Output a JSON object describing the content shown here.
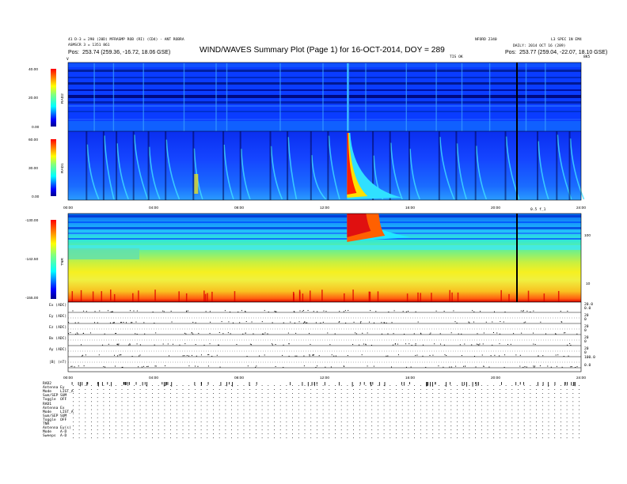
{
  "header": {
    "title": "WIND/WAVES Summary Plot (Page 1) for 16-OCT-2014, DOY = 289",
    "top_left_line1": "41 D-3 = 290 (20D) MFRASMP ROB (RI) (CD4) - ANT ROBRA",
    "top_left_line2": "ASMSCR 3 = 1351 861",
    "pos_left_label": "Pos:",
    "pos_left_value": "253.74 (259.36, -16.72, 18.06 GSE)",
    "top_right_code": "NFORD 2340",
    "top_right_label": "L3 SPEC 1N EM4",
    "top_right_daily": "DAILY: 2014 OCT 16 (289)",
    "pos_right_label": "Pos:",
    "pos_right_value": "253.77 (259.04, -22.07, 18.10 GSE)",
    "tiny_label": "TIS OK",
    "edge_left": "V",
    "edge_right": "8K5",
    "tiny_mark": "0.5 f_1"
  },
  "panels": {
    "rad2_label": "RAD2",
    "rad1_label": "RAD1",
    "tnr_label": "TNR",
    "rad2_scale": [
      "40.00",
      "20.00",
      "0.00"
    ],
    "rad1_scale": [
      "60.00",
      "30.00",
      "0.00"
    ],
    "tnr_scale": [
      "-130.00",
      "-142.50",
      "-155.00"
    ],
    "tnr_right_ticks": [
      "100",
      "10"
    ],
    "time_ticks": [
      "00:00",
      "04:00",
      "08:00",
      "12:00",
      "16:00",
      "20:00",
      "24:00"
    ],
    "mini_labels": [
      "Ex (ADC)",
      "Ey (ADC)",
      "Ez (ADC)",
      "Bx (ADC)",
      "Ay (ADC)",
      "|B| (nT)"
    ],
    "mini_right_ticks": [
      "20.0",
      "0.0",
      "20",
      "0",
      "20",
      "0",
      "20",
      "0",
      "20",
      "0",
      "100.0",
      "0.0"
    ]
  },
  "status_block": [
    {
      "label": "RAD2",
      "value": ""
    },
    {
      "label": "Antenna",
      "value": "Ey"
    },
    {
      "label": "Mode",
      "value": "LIST_A"
    },
    {
      "label": "Sum/SEP",
      "value": "SUM"
    },
    {
      "label": "Toggle",
      "value": "OFF"
    },
    {
      "label": "RAD1",
      "value": ""
    },
    {
      "label": "Antenna",
      "value": "Ex"
    },
    {
      "label": "Mode",
      "value": "LIST_A"
    },
    {
      "label": "Sum/SEP",
      "value": "SUM"
    },
    {
      "label": "Toggle",
      "value": "OFF"
    },
    {
      "label": "TNR",
      "value": ""
    },
    {
      "label": "Antenna",
      "value": "Ey(s)"
    },
    {
      "label": "Mode",
      "value": "A-D"
    },
    {
      "label": "Sweeps",
      "value": "A-D"
    }
  ],
  "colors": {
    "colormap": [
      "#00008f",
      "#0000ff",
      "#0080ff",
      "#00ffff",
      "#80ff80",
      "#ffff00",
      "#ff8000",
      "#ff0000",
      "#800000"
    ]
  },
  "chart_data": [
    {
      "type": "heatmap",
      "name": "RAD2",
      "xlabel": "",
      "ylabel": "RAD2",
      "xlim": [
        0,
        24
      ],
      "ylim": [
        0,
        40
      ],
      "colorbar_range": [
        0,
        40
      ],
      "background_level": 0.25,
      "burst_hours": [
        1.2,
        2.1,
        3.5,
        5.4,
        6.9,
        7.4,
        9.9,
        11.9,
        13.1,
        13.9,
        15.8,
        17.2,
        18.4,
        19.7,
        21.4,
        22.3
      ]
    },
    {
      "type": "heatmap",
      "name": "RAD1",
      "xlabel": "",
      "ylabel": "RAD1",
      "xlim": [
        0,
        24
      ],
      "ylim": [
        0,
        60
      ],
      "colorbar_range": [
        0,
        60
      ],
      "background_level": 0.3,
      "strong_burst_hour": 13.05,
      "burst_hours": [
        0.9,
        1.7,
        2.3,
        3.1,
        3.8,
        4.6,
        5.9,
        7.3,
        8.1,
        9.5,
        10.3,
        11.4,
        12.2,
        14.3,
        15.1,
        16.0,
        17.4,
        18.2,
        19.1,
        20.5,
        22.0,
        22.9,
        23.5
      ]
    },
    {
      "type": "heatmap",
      "name": "TNR",
      "xlabel": "",
      "ylabel": "TNR",
      "xlim": [
        0,
        24
      ],
      "ylim": [
        -155,
        -130
      ],
      "colorbar_range": [
        -155,
        -130
      ],
      "strong_burst_hour": 13.05,
      "data_gap_hour": 21.3
    },
    {
      "type": "line",
      "name": "Ex/Ey/Ez/Bx/Ay/|B|",
      "xlim": [
        0,
        24
      ],
      "series": [
        {
          "name": "Ex (ADC)",
          "level": 0.0
        },
        {
          "name": "Ey (ADC)",
          "level": 0.0
        },
        {
          "name": "Ez (ADC)",
          "level": 0.0
        },
        {
          "name": "Bx (ADC)",
          "level": 0.0
        },
        {
          "name": "Ay (ADC)",
          "level": 0.0
        },
        {
          "name": "|B| (nT)",
          "level": 10.0
        }
      ]
    }
  ]
}
